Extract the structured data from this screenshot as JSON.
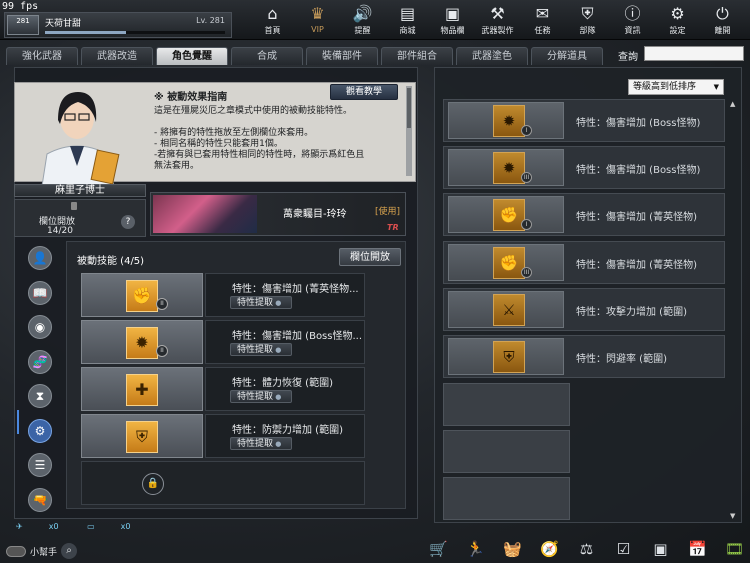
{
  "status": {
    "fps": "99 fps"
  },
  "profile": {
    "rank": "281",
    "username": "天荷甘甜",
    "level": "Lv. 281",
    "xp_fraction": 0.45
  },
  "nav": [
    {
      "label": "首頁",
      "icon": "home-icon",
      "glyph": "⌂"
    },
    {
      "label": "VIP",
      "icon": "vip-crown-icon",
      "glyph": "♛"
    },
    {
      "label": "提醒",
      "icon": "speaker-icon",
      "glyph": "🔊"
    },
    {
      "label": "商城",
      "icon": "store-icon",
      "glyph": "▤"
    },
    {
      "label": "物品欄",
      "icon": "bag-icon",
      "glyph": "▣"
    },
    {
      "label": "武器製作",
      "icon": "weapon-craft-icon",
      "glyph": "⚒"
    },
    {
      "label": "任務",
      "icon": "ticket-icon",
      "glyph": "✉"
    },
    {
      "label": "部隊",
      "icon": "shield-icon",
      "glyph": "⛨"
    },
    {
      "label": "資訊",
      "icon": "info-icon",
      "glyph": "ⓘ"
    },
    {
      "label": "設定",
      "icon": "gear-icon",
      "glyph": "⚙"
    },
    {
      "label": "離開",
      "icon": "power-icon",
      "glyph": "⏻"
    }
  ],
  "tabs": [
    "強化武器",
    "武器改造",
    "角色覺醒",
    "合成",
    "裝備部件",
    "部件組合",
    "武器塗色",
    "分解道具"
  ],
  "active_tab": 2,
  "search": {
    "label": "查詢",
    "value": ""
  },
  "guide": {
    "title": "※  被動效果指南",
    "watch_button": "觀看教學",
    "lines": [
      "這是在殭屍災厄之章模式中使用的被動技能特性。",
      "",
      "- 將擁有的特性拖放至左側欄位來套用。",
      "- 相同名稱的特性只能套用1個。",
      "-若擁有與已套用特性相同的特性時，將顯示爲紅色且",
      "無法套用。"
    ]
  },
  "character": {
    "name": "麻里子博士",
    "slot_open_label": "欄位開放",
    "slot_count": "14/20",
    "help": "?"
  },
  "banner": {
    "title": "萬衆矚目-玲玲",
    "status": "[使用]",
    "tag": "TR"
  },
  "side_icons": [
    {
      "name": "profile-icon",
      "glyph": "👤"
    },
    {
      "name": "book-icon",
      "glyph": "📖"
    },
    {
      "name": "eye-icon",
      "glyph": "◉"
    },
    {
      "name": "dna-icon",
      "glyph": "🧬"
    },
    {
      "name": "hourglass-icon",
      "glyph": "⧗"
    },
    {
      "name": "cog-icon",
      "glyph": "⚙"
    },
    {
      "name": "list-icon",
      "glyph": "☰"
    },
    {
      "name": "gun-icon",
      "glyph": "🔫"
    }
  ],
  "active_side_icon": 5,
  "skills": {
    "title": "被動技能 (4/5)",
    "slot_open_button": "欄位開放",
    "items": [
      {
        "name": "特性：傷害增加 (菁英怪物...",
        "extract": "特性提取",
        "grade": "II",
        "glyph": "✊"
      },
      {
        "name": "特性：傷害增加 (Boss怪物...",
        "extract": "特性提取",
        "grade": "II",
        "glyph": "✹"
      },
      {
        "name": "特性：體力恢復 (範圍)",
        "extract": "特性提取",
        "grade": "",
        "glyph": "✚"
      },
      {
        "name": "特性：防禦力增加 (範圍)",
        "extract": "特性提取",
        "grade": "",
        "glyph": "⛨"
      }
    ],
    "locked_slot": "🔒"
  },
  "counters": [
    {
      "icon": "plane-icon",
      "value": "x0"
    },
    {
      "icon": "ticket-icon",
      "value": "x0"
    }
  ],
  "sort": {
    "selected": "等級高到低排序"
  },
  "traits": [
    {
      "name": "特性：傷害增加 (Boss怪物)",
      "grade": "I",
      "glyph": "✹"
    },
    {
      "name": "特性：傷害增加 (Boss怪物)",
      "grade": "III",
      "glyph": "✹"
    },
    {
      "name": "特性：傷害增加 (菁英怪物)",
      "grade": "I",
      "glyph": "✊"
    },
    {
      "name": "特性：傷害增加 (菁英怪物)",
      "grade": "III",
      "glyph": "✊"
    },
    {
      "name": "特性：攻擊力增加 (範圍)",
      "grade": "",
      "glyph": "⚔"
    },
    {
      "name": "特性：閃避率 (範圍)",
      "grade": "",
      "glyph": "⛨"
    }
  ],
  "helper": {
    "label": "小幫手"
  },
  "bottom_icons": [
    {
      "name": "cart-icon",
      "glyph": "🛒",
      "accent": "#e45ad6"
    },
    {
      "name": "runner-icon",
      "glyph": "🏃",
      "accent": ""
    },
    {
      "name": "basket-icon",
      "glyph": "🧺",
      "accent": ""
    },
    {
      "name": "compass-icon",
      "glyph": "🧭",
      "accent": ""
    },
    {
      "name": "scale-icon",
      "glyph": "⚖",
      "accent": ""
    },
    {
      "name": "checklist-icon",
      "glyph": "☑",
      "accent": ""
    },
    {
      "name": "bookmark-icon",
      "glyph": "▣",
      "accent": ""
    },
    {
      "name": "calendar-icon",
      "glyph": "📅",
      "accent": ""
    },
    {
      "name": "film-icon",
      "glyph": "🎞",
      "accent": "#9ad14b"
    }
  ]
}
